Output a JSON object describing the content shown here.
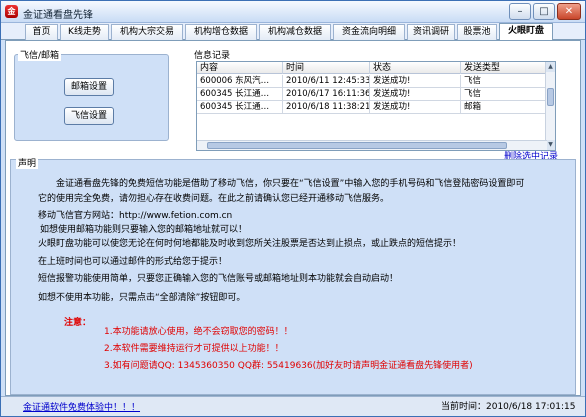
{
  "window": {
    "title": "金证通看盘先锋",
    "icon_text": "金",
    "controls": {
      "minimize": "–",
      "maximize": "□",
      "close": "✕"
    }
  },
  "tabs": [
    {
      "label": "首页"
    },
    {
      "label": "K线走势"
    },
    {
      "label": "机构大宗交易"
    },
    {
      "label": "机构增仓数据"
    },
    {
      "label": "机构减仓数据"
    },
    {
      "label": "资金流向明细"
    },
    {
      "label": "资讯调研"
    },
    {
      "label": "股票池"
    },
    {
      "label": "火眼盯盘",
      "active": true
    }
  ],
  "fetion_group": {
    "label": "飞信/邮箱",
    "email_button": "邮箱设置",
    "fetion_button": "飞信设置"
  },
  "records": {
    "label": "信息记录",
    "columns": [
      "内容",
      "时间",
      "状态",
      "发送类型"
    ],
    "rows": [
      {
        "content": "600006 东风汽…",
        "time": "2010/6/11 12:45:33",
        "status": "发送成功!",
        "type": "飞信"
      },
      {
        "content": "600345 长江通…",
        "time": "2010/6/17 16:11:36",
        "status": "发送成功!",
        "type": "飞信"
      },
      {
        "content": "600345 长江通…",
        "time": "2010/6/18 11:38:21",
        "status": "发送成功!",
        "type": "邮箱"
      }
    ],
    "delete_link": "删除选中记录"
  },
  "statement": {
    "label": "声明",
    "paragraphs": [
      "金证通看盘先锋的免费短信功能是借助了移动飞信，你只要在“飞信设置”中输入您的手机号码和飞信登陆密码设置即可",
      "它的使用完全免费，请勿担心存在收费问题。在此之前请确认您已经开通移动飞信服务。",
      "移动飞信官方网站：http://www.fetion.com.cn",
      "如想使用邮箱功能则只要输入您的邮箱地址就可以！",
      "火眼盯盘功能可以使您无论在何时何地都能及时收到您所关注股票是否达到止损点，或止跌点的短信提示！",
      "在上班时间也可以通过邮件的形式给您于提示！",
      "短信报警功能使用简单，只要您正确输入您的飞信账号或邮箱地址则本功能就会自动启动！",
      "如想不使用本功能，只需点击“全部清除”按钮即可。"
    ],
    "notice_label": "注意：",
    "notices": [
      "1.本功能请放心使用，绝不会窃取您的密码！！",
      "2.本软件需要维持运行才可提供以上功能！！",
      "3.如有问题请QQ: 1345360350    QQ群: 55419636(加好友时请声明金证通看盘先锋使用者)"
    ]
  },
  "statusbar": {
    "link": "金证通软件免费体验中！！！",
    "time": "当前时间：2010/6/18 17:01:15"
  }
}
